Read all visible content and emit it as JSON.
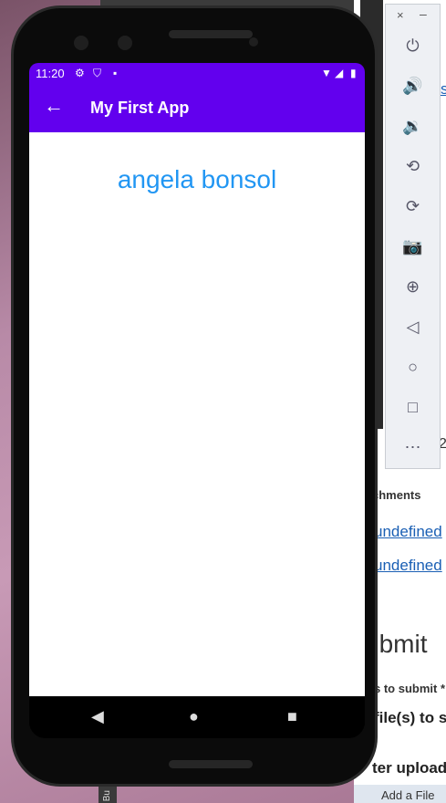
{
  "status_bar": {
    "time": "11:20"
  },
  "app_bar": {
    "title": "My First App"
  },
  "content": {
    "name_text": "angela bonsol"
  },
  "emulator_toolbar": {
    "close": "×",
    "minimize": "–",
    "buttons": [
      "power-icon",
      "volume-up-icon",
      "volume-down-icon",
      "rotate-left-icon",
      "rotate-right-icon",
      "camera-icon",
      "zoom-icon",
      "back-icon",
      "home-icon",
      "overview-icon",
      "more-icon"
    ]
  },
  "webpage": {
    "attachments_label": "chments",
    "link1": "undefined",
    "link2": "undefined",
    "heading": "ubmit",
    "files_label": "s to submit *",
    "files_text": "file(s) to s",
    "after_upload": "ter upload",
    "add_file": "Add a File",
    "frag_s": "s",
    "frag_num": "2"
  },
  "taskbar": {
    "label": "Bu"
  }
}
